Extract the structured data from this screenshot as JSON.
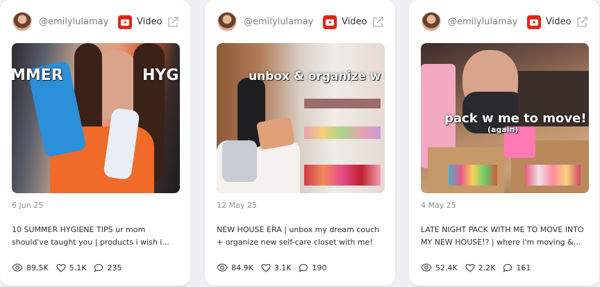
{
  "cards": [
    {
      "handle": "@emilylulamay",
      "type_label": "Video",
      "thumb_text": [
        "MMER",
        "HYGIEN"
      ],
      "date": "6 Jun 25",
      "title_lines": [
        "10 SUMMER HYGIENE TIPS ur mom",
        "should've taught you | products i wish i..."
      ],
      "views": "89.5K",
      "likes": "5.1K",
      "comments": "235"
    },
    {
      "handle": "@emilylulamay",
      "type_label": "Video",
      "thumb_text": [
        "unbox & organize w me"
      ],
      "date": "12 May 25",
      "title_lines": [
        "NEW HOUSE ERA | unbox my dream couch",
        "+ organize new self-care closet with me!"
      ],
      "views": "84.9K",
      "likes": "3.1K",
      "comments": "190"
    },
    {
      "handle": "@emilylulamay",
      "type_label": "Video",
      "thumb_text": [
        "pack w me to move!",
        "(again)"
      ],
      "date": "4 May 25",
      "title_lines": [
        "LATE NIGHT PACK WITH ME TO MOVE INTO",
        "MY NEW HOUSE!? | where i'm moving &..."
      ],
      "views": "52.4K",
      "likes": "2.2K",
      "comments": "161"
    }
  ],
  "colors": {
    "youtube_red": "#e0261b",
    "card_bg": "#ffffff",
    "page_bg": "#eef0f3"
  },
  "icons": [
    "youtube-icon",
    "external-link-icon",
    "eye-icon",
    "heart-icon",
    "comment-icon"
  ]
}
